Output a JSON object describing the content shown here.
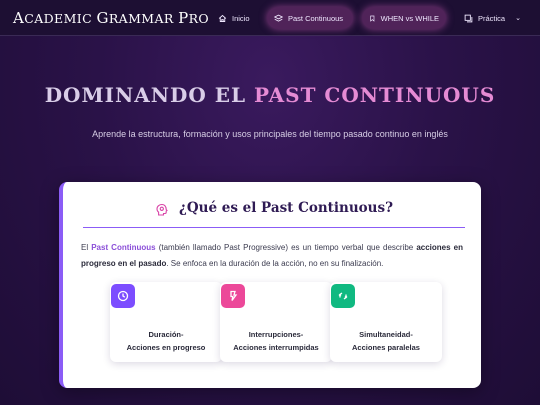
{
  "navbar": {
    "brand_big_1": "A",
    "brand_rest_1": "CADEMIC ",
    "brand_big_2": "G",
    "brand_rest_2": "RAMMAR ",
    "brand_big_3": "P",
    "brand_rest_3": "RO",
    "items": [
      {
        "label": "Inicio",
        "icon": "home-icon",
        "active": false
      },
      {
        "label": "Past Continuous",
        "icon": "layers-icon",
        "active": true
      },
      {
        "label": "WHEN vs WHILE",
        "icon": "bookmark-icon",
        "active": true
      },
      {
        "label": "Práctica",
        "icon": "copy-icon",
        "active": false,
        "dropdown": true
      }
    ],
    "chevron": "⌄"
  },
  "hero": {
    "title_part1": "DOMINANDO EL ",
    "title_part2": "PAST CONTINUOUS",
    "subtitle": "Aprende la estructura, formación y usos principales del tiempo pasado continuo en inglés"
  },
  "card": {
    "title": "¿Qué es el Past Continuous?",
    "head_icon": "brain-icon",
    "text": {
      "p1": "El ",
      "highlight": "Past Continuous",
      "p2": " (también llamado Past Progressive) es un tiempo verbal que describe ",
      "bold": "acciones en progreso en el pasado",
      "p3": ". Se enfoca en la duración de la acción, no en su finalización."
    },
    "features": [
      {
        "line1": "Duración-",
        "line2": "Acciones en progreso",
        "icon": "clock-icon",
        "color": "#7c4dff"
      },
      {
        "line1": "Interrupciones-",
        "line2": "Acciones interrumpidas",
        "icon": "bolt-icon",
        "color": "#ec4899"
      },
      {
        "line1": "Simultaneidad-",
        "line2": "Acciones paralelas",
        "icon": "sync-icon",
        "color": "#10b981"
      }
    ]
  },
  "colors": {
    "accent": "#8b5cf6",
    "pink": "#e58bd4",
    "background": "#2a1248"
  }
}
